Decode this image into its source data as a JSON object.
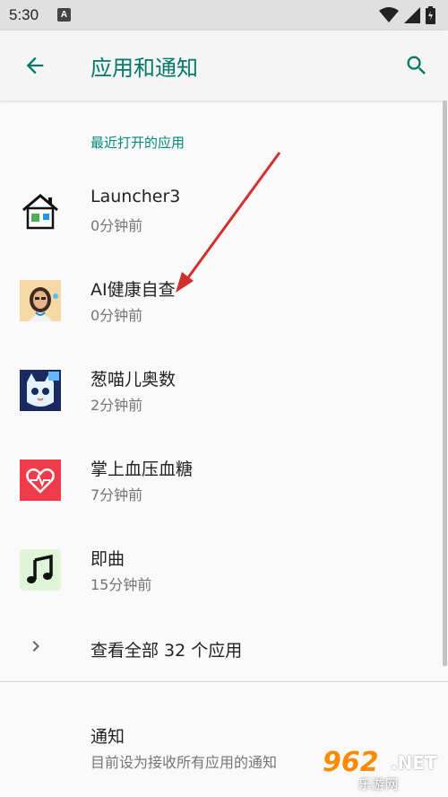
{
  "status_bar": {
    "time": "5:30",
    "notification_icon": "A",
    "icons": [
      "wifi-icon",
      "signal-icon",
      "battery-icon"
    ]
  },
  "app_bar": {
    "title": "应用和通知",
    "back_icon": "arrow-back-icon",
    "search_icon": "search-icon"
  },
  "recent_apps": {
    "header": "最近打开的应用",
    "items": [
      {
        "name": "Launcher3",
        "time": "0分钟前",
        "icon": "home-icon"
      },
      {
        "name": "AI健康自查",
        "time": "0分钟前",
        "icon": "ai-doctor-icon"
      },
      {
        "name": "葱喵儿奥数",
        "time": "2分钟前",
        "icon": "cat-math-icon"
      },
      {
        "name": "掌上血压血糖",
        "time": "7分钟前",
        "icon": "heart-icon"
      },
      {
        "name": "即曲",
        "time": "15分钟前",
        "icon": "music-note-icon"
      }
    ]
  },
  "see_all": {
    "label": "查看全部 32 个应用",
    "icon": "chevron-right-icon"
  },
  "notifications": {
    "title": "通知",
    "subtitle": "目前设为接收所有应用的通知"
  },
  "watermark": {
    "number": "962",
    "domain": ".NET",
    "sub": "乐游网"
  },
  "colors": {
    "accent": "#00796b",
    "annotation_arrow": "#d32f2f"
  }
}
